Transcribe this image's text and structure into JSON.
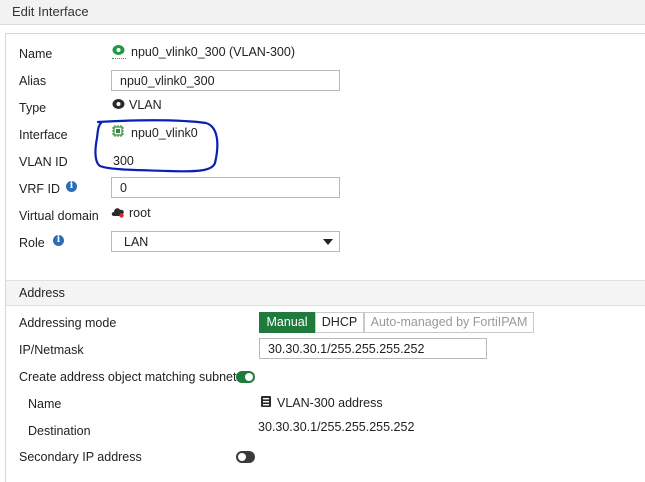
{
  "header": {
    "title": "Edit Interface"
  },
  "fields": {
    "name_label": "Name",
    "name_value": "npu0_vlink0_300 (VLAN-300)",
    "alias_label": "Alias",
    "alias_value": "npu0_vlink0_300",
    "type_label": "Type",
    "type_value": "VLAN",
    "interface_label": "Interface",
    "interface_value": "npu0_vlink0",
    "vlan_id_label": "VLAN ID",
    "vlan_id_value": "300",
    "vrf_id_label": "VRF ID",
    "vrf_id_value": "0",
    "vdom_label": "Virtual domain",
    "vdom_value": "root",
    "role_label": "Role",
    "role_value": "LAN"
  },
  "address": {
    "section_title": "Address",
    "mode_label": "Addressing mode",
    "modes": [
      "Manual",
      "DHCP",
      "Auto-managed by FortiIPAM"
    ],
    "active_mode": "Manual",
    "ipnetmask_label": "IP/Netmask",
    "ipnetmask_value": "30.30.30.1/255.255.255.252",
    "create_obj_label": "Create address object matching subnet",
    "create_obj_enabled": true,
    "obj_name_label": "Name",
    "obj_name_value": "VLAN-300 address",
    "destination_label": "Destination",
    "destination_value": "30.30.30.1/255.255.255.252",
    "secondary_ip_label": "Secondary IP address",
    "secondary_ip_enabled": false
  },
  "colors": {
    "accent_green": "#1f7a3c",
    "annotation_blue": "#0a1fb5",
    "info_blue": "#2a6eb8"
  },
  "icons": {
    "name": "vlan-green-icon",
    "type": "vlan-dark-icon",
    "interface": "npu-chip-icon",
    "vdom": "vdom-cloud-icon",
    "address_object": "address-object-icon",
    "info": "info-icon"
  }
}
